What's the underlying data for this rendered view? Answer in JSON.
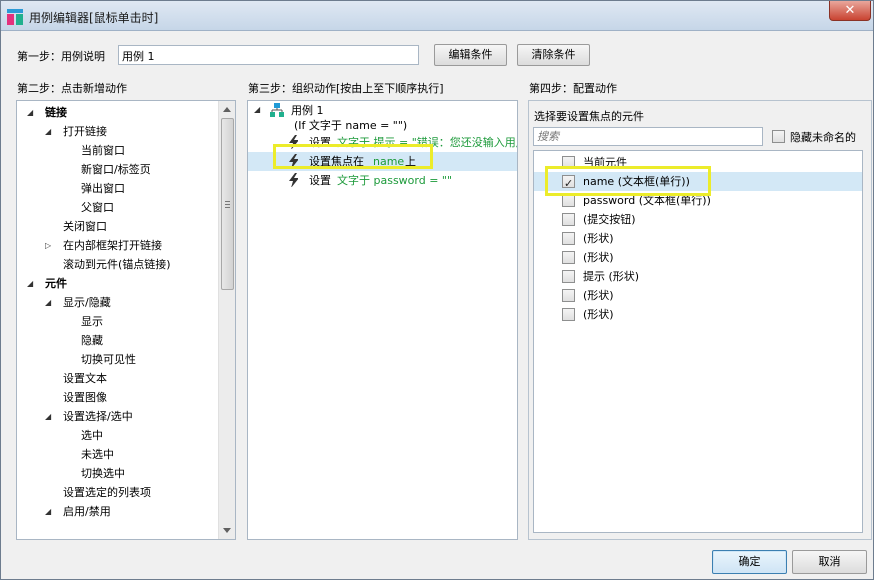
{
  "window": {
    "title": "用例编辑器[鼠标单击时]",
    "close_symbol": "✕"
  },
  "step1": {
    "label": "第一步：用例说明",
    "case_name": "用例 1",
    "edit_conditions": "编辑条件",
    "clear_conditions": "清除条件"
  },
  "step2": {
    "title": "第二步：点击新增动作",
    "tree": [
      {
        "label": "链接",
        "level": 0,
        "bold": true,
        "expander": "open"
      },
      {
        "label": "打开链接",
        "level": 1,
        "expander": "open"
      },
      {
        "label": "当前窗口",
        "level": 2
      },
      {
        "label": "新窗口/标签页",
        "level": 2
      },
      {
        "label": "弹出窗口",
        "level": 2
      },
      {
        "label": "父窗口",
        "level": 2
      },
      {
        "label": "关闭窗口",
        "level": 1
      },
      {
        "label": "在内部框架打开链接",
        "level": 1,
        "expander": "closed"
      },
      {
        "label": "滚动到元件(锚点链接)",
        "level": 1
      },
      {
        "label": "元件",
        "level": 0,
        "bold": true,
        "expander": "open"
      },
      {
        "label": "显示/隐藏",
        "level": 1,
        "expander": "open"
      },
      {
        "label": "显示",
        "level": 2
      },
      {
        "label": "隐藏",
        "level": 2
      },
      {
        "label": "切换可见性",
        "level": 2
      },
      {
        "label": "设置文本",
        "level": 1
      },
      {
        "label": "设置图像",
        "level": 1
      },
      {
        "label": "设置选择/选中",
        "level": 1,
        "expander": "open"
      },
      {
        "label": "选中",
        "level": 2
      },
      {
        "label": "未选中",
        "level": 2
      },
      {
        "label": "切换选中",
        "level": 2
      },
      {
        "label": "设置选定的列表项",
        "level": 1
      },
      {
        "label": "启用/禁用",
        "level": 1,
        "expander": "open"
      }
    ]
  },
  "step3": {
    "title": "第三步：组织动作[按由上至下顺序执行]",
    "case_label": "用例 1",
    "condition": "(If 文字于 name = \"\")",
    "actions": [
      {
        "verb": "设置",
        "detail": "文字于 提示 = \"错误：您还没输入用户名\"",
        "plain": "",
        "selected": false
      },
      {
        "verb": "设置焦点在",
        "detail": "name",
        "plain": "上",
        "selected": true
      },
      {
        "verb": "设置",
        "detail": "文字于 password = \"\"",
        "plain": "",
        "selected": false
      }
    ]
  },
  "step4": {
    "title": "第四步：配置动作",
    "subtitle": "选择要设置焦点的元件",
    "search_placeholder": "搜索",
    "hide_unnamed_label": "隐藏未命名的",
    "elements": [
      {
        "label": "当前元件",
        "checked": false,
        "selected": false
      },
      {
        "label": "name (文本框(单行))",
        "checked": true,
        "selected": true
      },
      {
        "label": "password (文本框(单行))",
        "checked": false,
        "selected": false
      },
      {
        "label": "(提交按钮)",
        "checked": false,
        "selected": false
      },
      {
        "label": "(形状)",
        "checked": false,
        "selected": false
      },
      {
        "label": "(形状)",
        "checked": false,
        "selected": false
      },
      {
        "label": "提示 (形状)",
        "checked": false,
        "selected": false
      },
      {
        "label": "(形状)",
        "checked": false,
        "selected": false
      },
      {
        "label": "(形状)",
        "checked": false,
        "selected": false
      }
    ]
  },
  "footer": {
    "ok": "确定",
    "cancel": "取消"
  },
  "colors": {
    "selection": "#d3e8f6",
    "highlight": "#ecec2a",
    "green_text": "#1c9a3a"
  }
}
